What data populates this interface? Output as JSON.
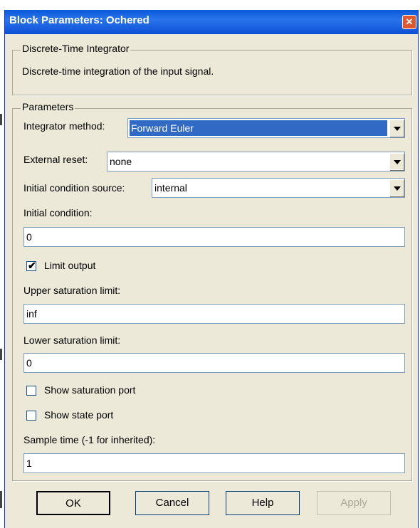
{
  "window": {
    "title": "Block Parameters: Ochered",
    "close_glyph": "✕"
  },
  "description": {
    "group_title": "Discrete-Time Integrator",
    "text": "Discrete-time integration of the input signal."
  },
  "parameters": {
    "group_title": "Parameters",
    "integrator_method": {
      "label": "Integrator method:",
      "value": "Forward Euler"
    },
    "external_reset": {
      "label": "External reset:",
      "value": "none"
    },
    "initial_condition_source": {
      "label": "Initial condition source:",
      "value": "internal"
    },
    "initial_condition": {
      "label": "Initial condition:",
      "value": "0"
    },
    "limit_output": {
      "label": "Limit output",
      "checked": true
    },
    "upper_saturation": {
      "label": "Upper saturation limit:",
      "value": "inf"
    },
    "lower_saturation": {
      "label": "Lower saturation limit:",
      "value": "0"
    },
    "show_saturation_port": {
      "label": "Show saturation port",
      "checked": false
    },
    "show_state_port": {
      "label": "Show state port",
      "checked": false
    },
    "sample_time": {
      "label": "Sample time (-1 for inherited):",
      "value": "1"
    }
  },
  "buttons": {
    "ok": "OK",
    "cancel": "Cancel",
    "help": "Help",
    "apply": "Apply"
  },
  "icons": {
    "close": "close-icon",
    "checkmark": "✔"
  },
  "colors": {
    "title_bar": "#0a58d8",
    "selection": "#316ac5",
    "dialog_bg": "#ece9d8"
  }
}
